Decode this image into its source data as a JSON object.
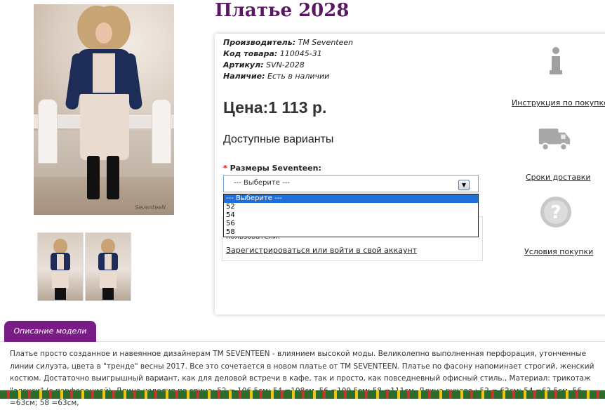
{
  "product": {
    "title": "Платье 2028",
    "info": [
      {
        "label": "Производитель:",
        "value": "TM Seventeen"
      },
      {
        "label": "Код товара:",
        "value": "110045-31"
      },
      {
        "label": "Артикул:",
        "value": "SVN-2028"
      },
      {
        "label": "Наличие:",
        "value": "Есть в наличии"
      }
    ],
    "price": "Цена:1 113 р.",
    "variants_heading": "Доступные варианты",
    "photo_signature": "SeventeeN"
  },
  "size_select": {
    "required_mark": "*",
    "label": "Размеры Seventeen:",
    "selected": "--- Выберите ---",
    "options": [
      "--- Выберите ---",
      "52",
      "54",
      "56",
      "58"
    ]
  },
  "login": {
    "note": "пользователи!",
    "link": "Зарегистрироваться или войти в свой аккаунт"
  },
  "sidebar": {
    "items": [
      {
        "icon": "info-icon",
        "label": "Инструкция по покупке"
      },
      {
        "icon": "truck-icon",
        "label": "Сроки доставки"
      },
      {
        "icon": "question-icon",
        "label": "Условия покупки"
      }
    ]
  },
  "description": {
    "tab_label": "Описание модели",
    "text": "Платье просто созданное и навеянное дизайнерам TM SEVENTEEN - влиянием высокой моды. Великолепно выполненная перфорация, утонченные линии силуэта, цвета в \"тренде\" весны 2017. Все это сочетается в новом платье от TM SEVENTEEN. Платье по фасону напоминает строгий, женский костюм. Достаточно выигрышный вариант, как для деловой встречи в кафе, так и просто, как повседневный офисный стиль., Материал: трикотаж \"алекси\" (с перфорацией), Длина изделия по спине: 52 = 106,5см; 54 =108см, 56 =109,5см; 58 =111см, Длина рукава : 52 = 62см; 54 =62,5см, 56 =63см; 58 =63см,"
  },
  "colors": {
    "title": "#5b1763",
    "tab": "#7a1c85",
    "dropdown_highlight": "#1e6fd9"
  }
}
